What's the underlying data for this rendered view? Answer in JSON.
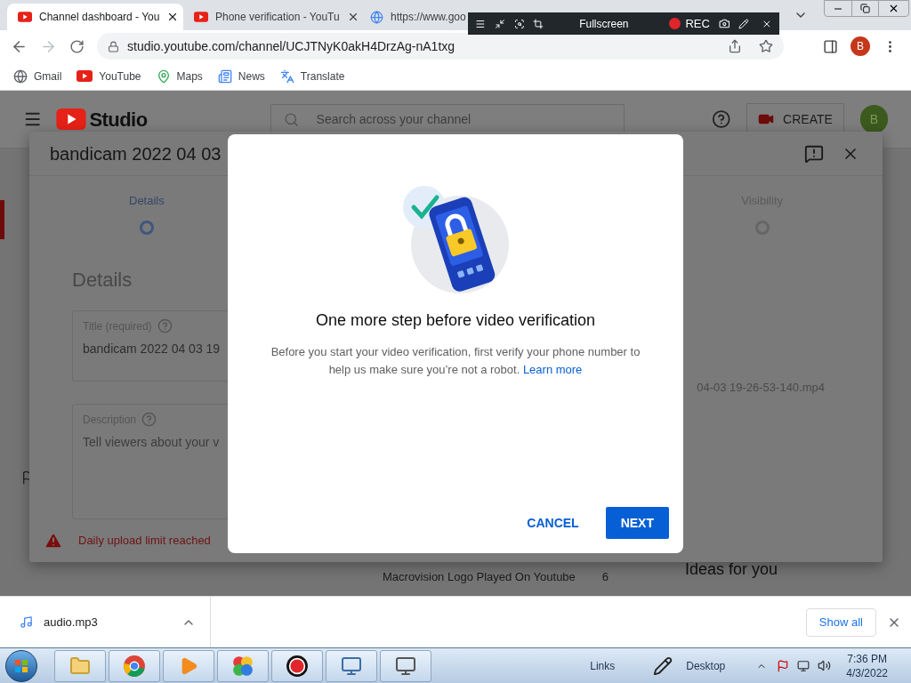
{
  "browser": {
    "tabs": [
      {
        "title": "Channel dashboard - You",
        "selected": true
      },
      {
        "title": "Phone verification - YouTu",
        "selected": false
      },
      {
        "title": "https://www.goo",
        "selected": false
      }
    ],
    "url": "studio.youtube.com/channel/UCJTNyK0akH4DrzAg-nA1txg",
    "profile_initial": "B",
    "bookmarks": [
      {
        "label": "Gmail",
        "kind": "globe"
      },
      {
        "label": "YouTube",
        "kind": "youtube"
      },
      {
        "label": "Maps",
        "kind": "maps"
      },
      {
        "label": "News",
        "kind": "news"
      },
      {
        "label": "Translate",
        "kind": "translate"
      }
    ]
  },
  "recorder_toolbar": {
    "mode": "Fullscreen",
    "rec_label": "REC"
  },
  "studio_header": {
    "logo_text": "Studio",
    "search_placeholder": "Search across your channel",
    "create_label": "CREATE",
    "avatar_initial": "B"
  },
  "upload_dialog": {
    "title": "bandicam 2022 04 03",
    "steps": [
      {
        "label": "Details",
        "selected": true
      },
      {
        "label": "Visibility",
        "selected": false
      }
    ],
    "section_title": "Details",
    "title_field": {
      "label": "Title (required)",
      "value": "bandicam 2022 04 03 19"
    },
    "description_field": {
      "label": "Description",
      "placeholder": "Tell viewers about your v"
    },
    "file_name": "04-03 19-26-53-140.mp4",
    "warning": "Daily upload limit reached"
  },
  "background": {
    "video_title": "Macrovision Logo Played On Youtube",
    "video_count": "6",
    "ideas_heading": "Ideas for you"
  },
  "modal": {
    "heading": "One more step before video verification",
    "body": "Before you start your video verification, first verify your phone number to help us make sure you’re not a robot.",
    "link": "Learn more",
    "buttons": [
      {
        "label": "CANCEL",
        "kind": "text"
      },
      {
        "label": "NEXT",
        "kind": "primary"
      }
    ]
  },
  "download_bar": {
    "file": "audio.mp3",
    "show_all": "Show all"
  },
  "taskbar": {
    "toolbars": [
      "Links",
      "Desktop"
    ],
    "time": "7:36 PM",
    "date": "4/3/2022"
  }
}
